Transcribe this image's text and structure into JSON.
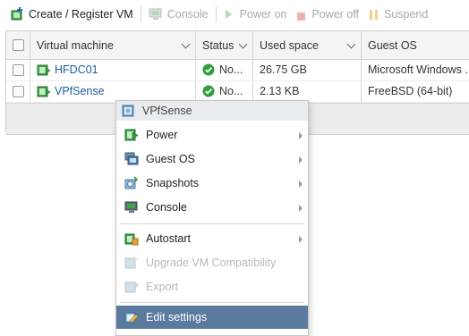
{
  "toolbar": {
    "create_label": "Create / Register VM",
    "console_label": "Console",
    "power_on_label": "Power on",
    "power_off_label": "Power off",
    "suspend_label": "Suspend"
  },
  "table": {
    "headers": {
      "vm": "Virtual machine",
      "status": "Status",
      "used_space": "Used space",
      "guest_os": "Guest OS"
    },
    "rows": [
      {
        "name": "HFDC01",
        "status": "No...",
        "used_space": "26.75 GB",
        "guest_os": "Microsoft Windows ..."
      },
      {
        "name": "VPfSense",
        "status": "No...",
        "used_space": "2.13 KB",
        "guest_os": "FreeBSD (64-bit)"
      }
    ]
  },
  "context_menu": {
    "title": "VPfSense",
    "items": [
      {
        "label": "Power",
        "icon": "power-icon",
        "submenu": true,
        "enabled": true
      },
      {
        "label": "Guest OS",
        "icon": "guest-os-icon",
        "submenu": true,
        "enabled": true
      },
      {
        "label": "Snapshots",
        "icon": "snapshots-icon",
        "submenu": true,
        "enabled": true
      },
      {
        "label": "Console",
        "icon": "console-icon",
        "submenu": true,
        "enabled": true
      },
      {
        "label": "Autostart",
        "icon": "autostart-icon",
        "submenu": true,
        "enabled": true
      },
      {
        "label": "Upgrade VM Compatibility",
        "icon": "upgrade-icon",
        "submenu": false,
        "enabled": false
      },
      {
        "label": "Export",
        "icon": "export-icon",
        "submenu": false,
        "enabled": false
      },
      {
        "label": "Edit settings",
        "icon": "edit-settings-icon",
        "submenu": false,
        "enabled": true,
        "selected": true
      }
    ]
  },
  "colors": {
    "link": "#1a5f9e",
    "status_ok": "#2e9e3e",
    "menu_selected": "#5a7b9e",
    "vm_icon": "#3fa548"
  }
}
